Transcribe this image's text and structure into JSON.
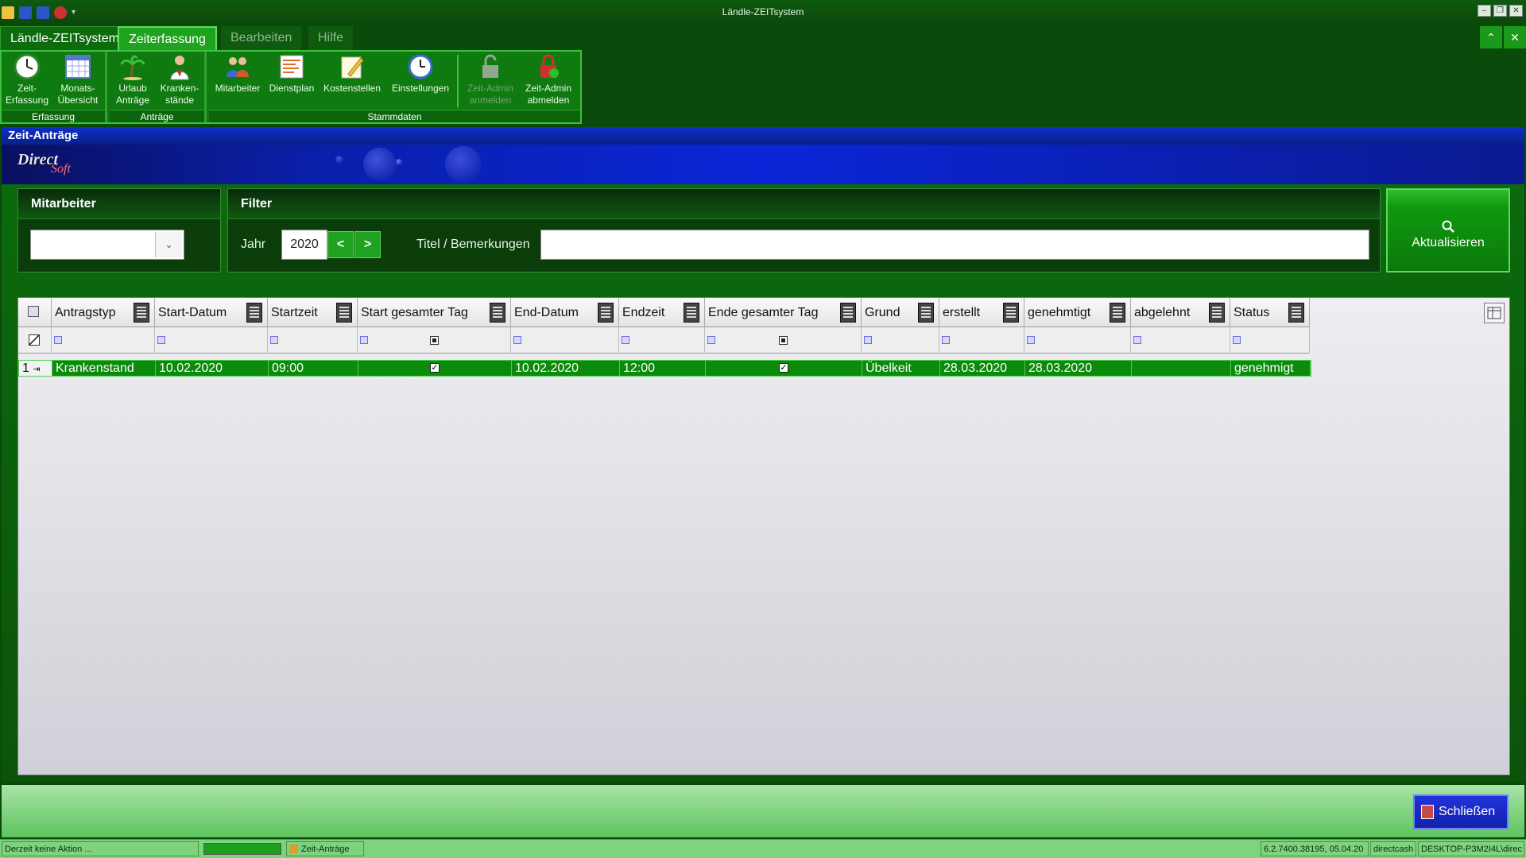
{
  "window": {
    "title": "Ländle-ZEITsystem"
  },
  "ribbon_tabs": [
    "Ländle-ZEITsystem",
    "Zeiterfassung",
    "Bearbeiten",
    "Hilfe"
  ],
  "ribbon": {
    "groups": [
      {
        "label": "Erfassung",
        "buttons": [
          {
            "label": "Zeit-\nErfassung",
            "icon": "clock-icon"
          },
          {
            "label": "Monats-\nÜbersicht",
            "icon": "calendar-icon"
          }
        ]
      },
      {
        "label": "Anträge",
        "buttons": [
          {
            "label": "Urlaub\nAnträge",
            "icon": "palm-tree-icon"
          },
          {
            "label": "Kranken-\nstände",
            "icon": "doctor-icon"
          }
        ]
      },
      {
        "label": "Stammdaten",
        "buttons": [
          {
            "label": "Mitarbeiter",
            "icon": "people-icon"
          },
          {
            "label": "Dienstplan",
            "icon": "schedule-icon"
          },
          {
            "label": "Kostenstellen",
            "icon": "pencil-note-icon"
          },
          {
            "label": "Einstellungen",
            "icon": "settings-clock-icon"
          },
          {
            "label": "Zeit-Admin\nanmelden",
            "icon": "lock-open-icon"
          },
          {
            "label": "Zeit-Admin\nabmelden",
            "icon": "lock-red-icon"
          }
        ]
      }
    ]
  },
  "form": {
    "title": "Zeit-Anträge",
    "logo_text": "Direct",
    "logo_sub": "Soft"
  },
  "mitarbeiter": {
    "title": "Mitarbeiter",
    "selected": ""
  },
  "filter": {
    "title": "Filter",
    "year_label": "Jahr",
    "year": "2020",
    "prev": "<",
    "next": ">",
    "title_label": "Titel / Bemerkungen",
    "title_value": ""
  },
  "refresh_label": "Aktualisieren",
  "grid": {
    "columns": [
      "Antragstyp",
      "Start-Datum",
      "Startzeit",
      "Start gesamter Tag",
      "End-Datum",
      "Endzeit",
      "Ende gesamter Tag",
      "Grund",
      "erstellt",
      "genehmtigt",
      "abgelehnt",
      "Status"
    ],
    "rows": [
      {
        "num": "1",
        "cells": [
          "Krankenstand",
          "10.02.2020",
          "09:00",
          "",
          "10.02.2020",
          "12:00",
          "",
          "Übelkeit",
          "28.03.2020",
          "28.03.2020",
          "",
          "genehmigt"
        ]
      }
    ]
  },
  "close_label": "Schließen",
  "status": {
    "message": "Derzeit keine Aktion ...",
    "progress": 1.0,
    "active_window": "Zeit-Anträge",
    "version": "6.2.7400.38195, 05.04.20",
    "database": "directcash",
    "machine": "DESKTOP-P3M2I4L\\direc"
  },
  "colors": {
    "accent": "#1fa31f",
    "title_blue": "#1030c8",
    "row_highlight": "#0c8a0c"
  }
}
